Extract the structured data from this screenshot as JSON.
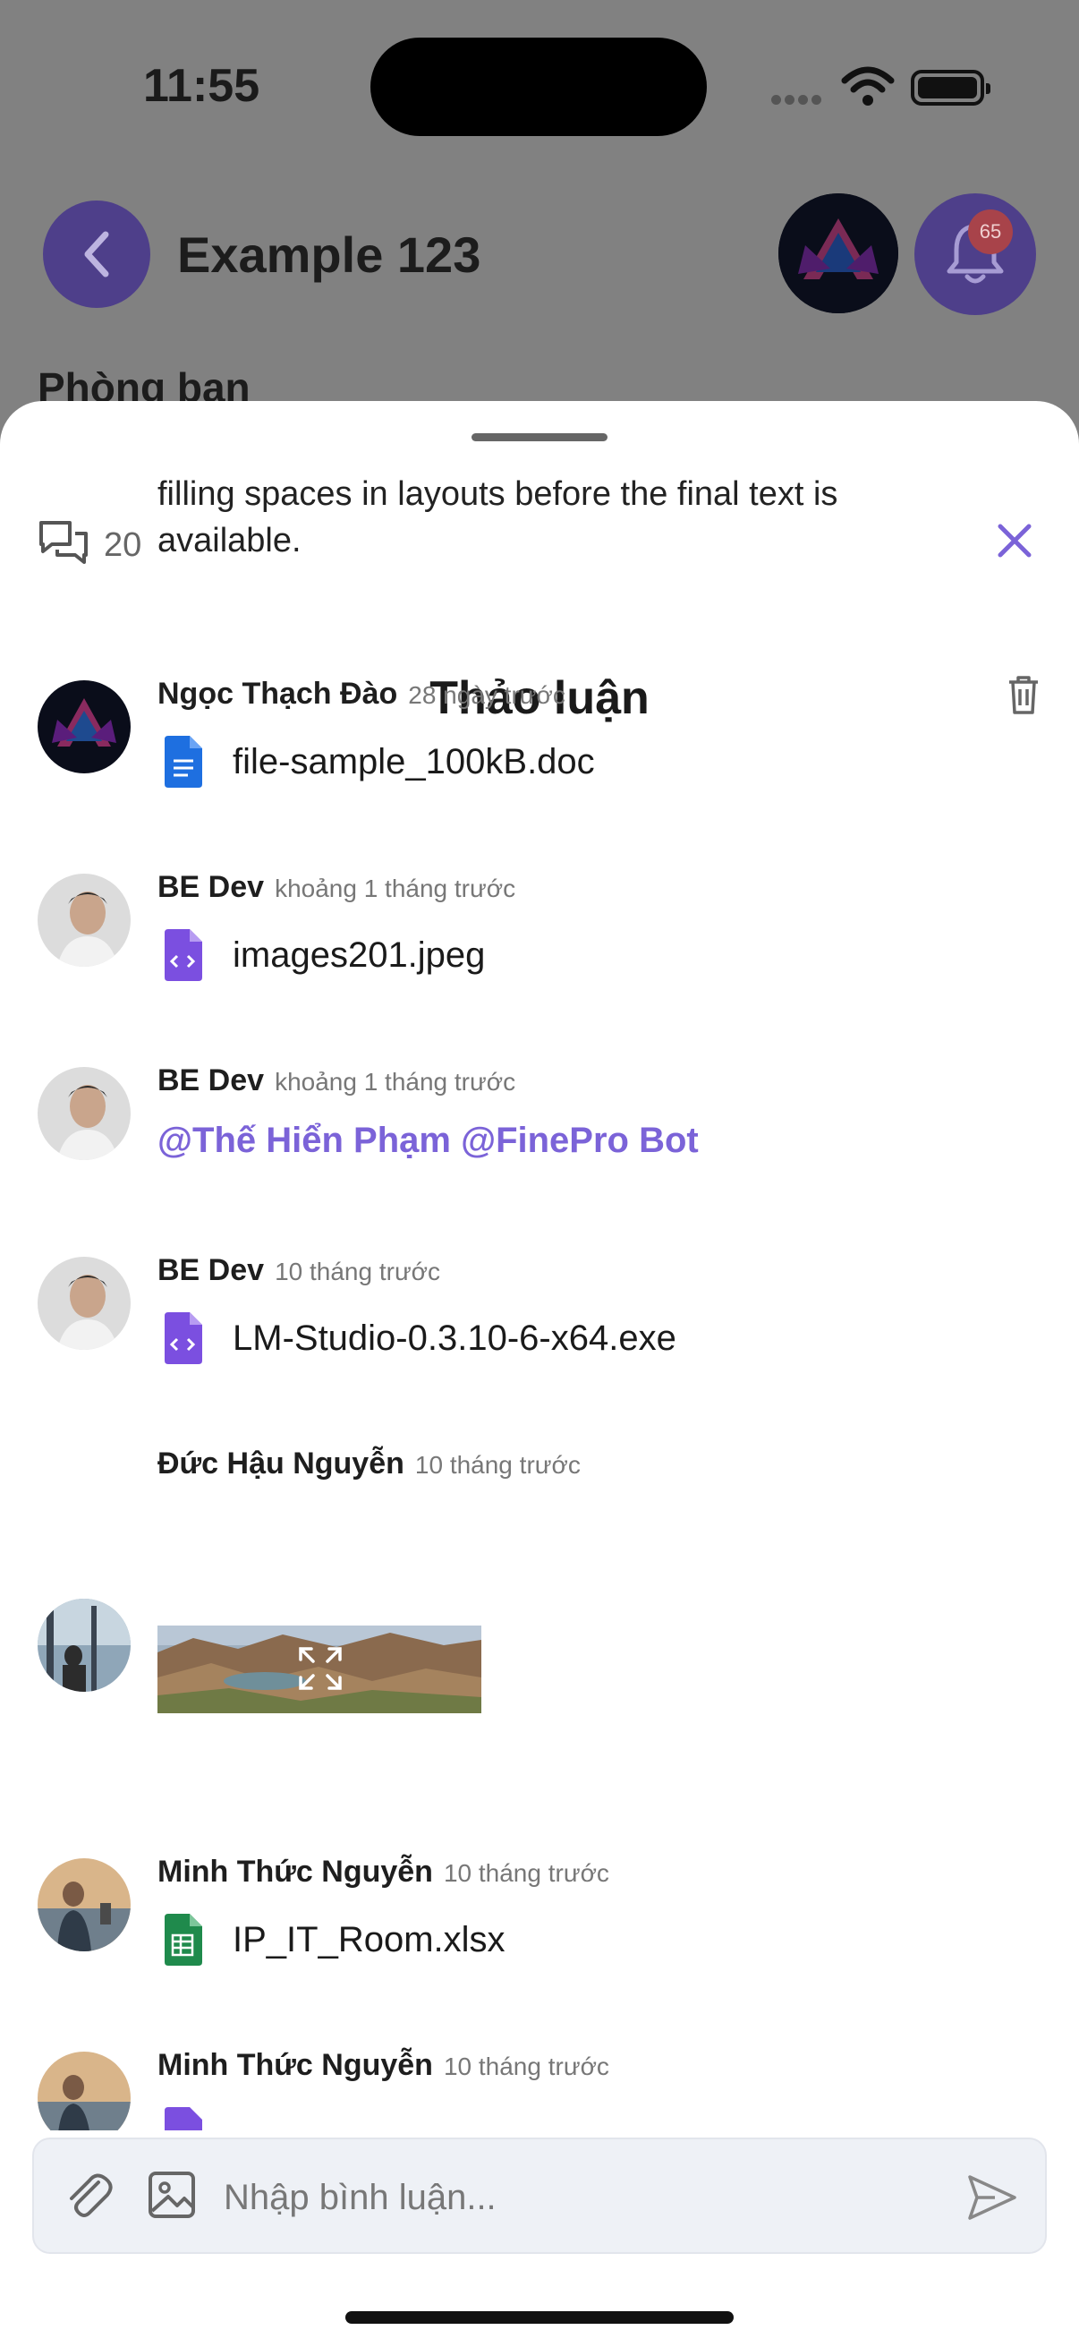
{
  "status_bar": {
    "time": "11:55"
  },
  "header": {
    "title": "Example 123",
    "notification_count": "65",
    "section_label": "Phòng ban"
  },
  "sheet": {
    "comment_count": "20",
    "description_line1": "filling spaces in layouts before the final text is",
    "description_line2": "available.",
    "title": "Thảo luận"
  },
  "comments": [
    {
      "author": "Ngọc Thạch Đào",
      "time": "28 ngày trước",
      "attachment": "file-sample_100kB.doc",
      "file_type": "doc"
    },
    {
      "author": "BE Dev",
      "time": "khoảng 1 tháng trước",
      "attachment": "images201.jpeg",
      "file_type": "code"
    },
    {
      "author": "BE Dev",
      "time": "khoảng 1 tháng trước",
      "mention_text": "@Thế Hiển Phạm @FinePro Bot"
    },
    {
      "author": "BE Dev",
      "time": "10 tháng trước",
      "attachment": "LM-Studio-0.3.10-6-x64.exe",
      "file_type": "code"
    },
    {
      "author": "Đức Hậu Nguyễn",
      "time": "10 tháng trước",
      "has_image": true
    },
    {
      "author": "Minh Thức Nguyễn",
      "time": "10 tháng trước",
      "attachment": "IP_IT_Room.xlsx",
      "file_type": "sheet"
    },
    {
      "author": "Minh Thức Nguyễn",
      "time": "10 tháng trước",
      "file_type": "code"
    }
  ],
  "composer": {
    "placeholder": "Nhập bình luận..."
  },
  "colors": {
    "accent": "#7b63d8",
    "header_button": "#4e3f8a",
    "doc_blue": "#1e6fe0",
    "sheet_green": "#1f8a4c",
    "code_purple": "#7b4fe0"
  },
  "icons": [
    "back-icon",
    "bell-icon",
    "comments-icon",
    "close-icon",
    "trash-icon",
    "doc-file-icon",
    "code-file-icon",
    "sheet-file-icon",
    "expand-icon",
    "attach-icon",
    "image-icon",
    "send-icon"
  ]
}
